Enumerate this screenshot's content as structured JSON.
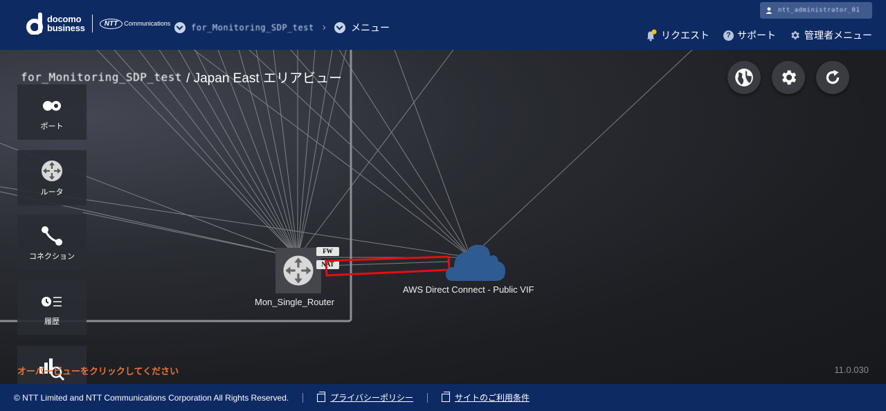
{
  "header": {
    "brand_top": "docomo",
    "brand_bottom": "business",
    "ntt_mark": "NTT",
    "ntt_text": "Communications",
    "breadcrumb_tenant": "for_Monitoring_SDP_test",
    "breadcrumb_menu": "メニュー",
    "user_name": "ntt_administrator_01",
    "links": {
      "request": "リクエスト",
      "support": "サポート",
      "admin_menu": "管理者メニュー"
    },
    "colors": {
      "bar": "#0d2a63",
      "notification_dot": "#f5c400"
    }
  },
  "canvas": {
    "tenant_name": "for_Monitoring_SDP_test",
    "area_title": "/ Japan East エリアビュー",
    "tools": {
      "port": "ポート",
      "router": "ルータ",
      "connection": "コネクション",
      "history": "履歴"
    },
    "hint": "オーバービューをクリックしてください",
    "version": "11.0.030",
    "router": {
      "name": "Mon_Single_Router",
      "badge_fw": "FW",
      "badge_nat": "NAT"
    },
    "cloud": {
      "name": "AWS Direct Connect - Public VIF",
      "color": "#2f5b93"
    },
    "highlight_color": "#e01010"
  },
  "footer": {
    "copyright": "© NTT Limited and NTT Communications Corporation All Rights Reserved.",
    "privacy": "プライバシーポリシー",
    "terms": "サイトのご利用条件"
  }
}
